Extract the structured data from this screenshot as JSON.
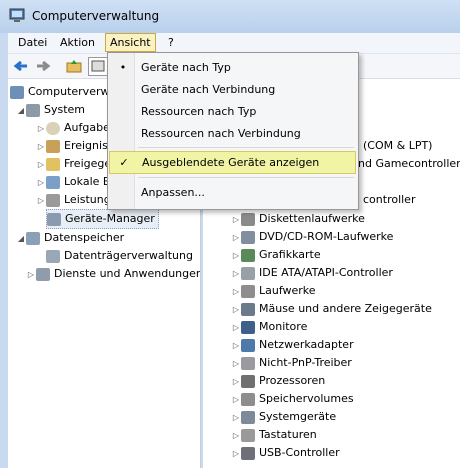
{
  "window": {
    "title": "Computerverwaltung"
  },
  "menubar": [
    "Datei",
    "Aktion",
    "Ansicht",
    "?"
  ],
  "dropdown": {
    "items": [
      {
        "label": "Geräte nach Typ",
        "mark": "•"
      },
      {
        "label": "Geräte nach Verbindung",
        "mark": ""
      },
      {
        "label": "Ressourcen nach Typ",
        "mark": ""
      },
      {
        "label": "Ressourcen nach Verbindung",
        "mark": ""
      },
      {
        "label": "Ausgeblendete Geräte anzeigen",
        "mark": "✓"
      },
      {
        "label": "Anpassen...",
        "mark": ""
      }
    ]
  },
  "tree": {
    "root": "Computerverwaltung",
    "system": "System",
    "system_children": [
      "Aufgabenplanung",
      "Ereignisanzeige",
      "Freigegebene Ordner",
      "Lokale Benutzer und Gruppen",
      "Leistung"
    ],
    "geraete_manager": "Geräte-Manager",
    "datenspeicher": "Datenspeicher",
    "datentraeger": "Datenträgerverwaltung",
    "dienste": "Dienste und Anwendungen"
  },
  "right_partial": [
    "(COM & LPT)",
    "nd Gamecontroller",
    "controller"
  ],
  "devices": [
    "Diskettenlaufwerke",
    "DVD/CD-ROM-Laufwerke",
    "Grafikkarte",
    "IDE ATA/ATAPI-Controller",
    "Laufwerke",
    "Mäuse und andere Zeigegeräte",
    "Monitore",
    "Netzwerkadapter",
    "Nicht-PnP-Treiber",
    "Prozessoren",
    "Speichervolumes",
    "Systemgeräte",
    "Tastaturen",
    "USB-Controller"
  ]
}
